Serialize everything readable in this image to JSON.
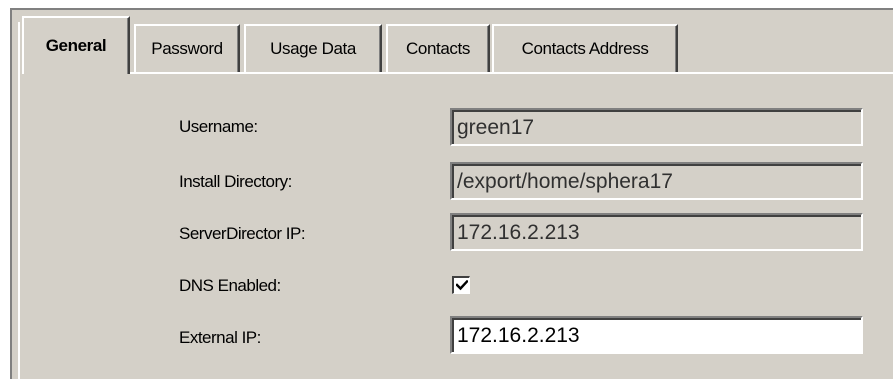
{
  "tabs": [
    {
      "label": "General",
      "active": true
    },
    {
      "label": "Password",
      "active": false
    },
    {
      "label": "Usage Data",
      "active": false
    },
    {
      "label": "Contacts",
      "active": false
    },
    {
      "label": "Contacts Address",
      "active": false
    }
  ],
  "form": {
    "username": {
      "label": "Username:",
      "value": "green17",
      "editable": false
    },
    "install_directory": {
      "label": "Install Directory:",
      "value": "/export/home/sphera17",
      "editable": false
    },
    "serverdirector_ip": {
      "label": "ServerDirector IP:",
      "value": "172.16.2.213",
      "editable": false
    },
    "dns_enabled": {
      "label": "DNS Enabled:",
      "checked": true
    },
    "external_ip": {
      "label": "External IP:",
      "value": "172.16.2.213",
      "editable": true
    }
  },
  "icons": {
    "checkbox_mark": "checkmark-icon"
  },
  "colors": {
    "face": "#d4d0c8",
    "highlight": "#ffffff",
    "shadow": "#808080",
    "dark_shadow": "#404040",
    "field_editable_bg": "#ffffff"
  }
}
